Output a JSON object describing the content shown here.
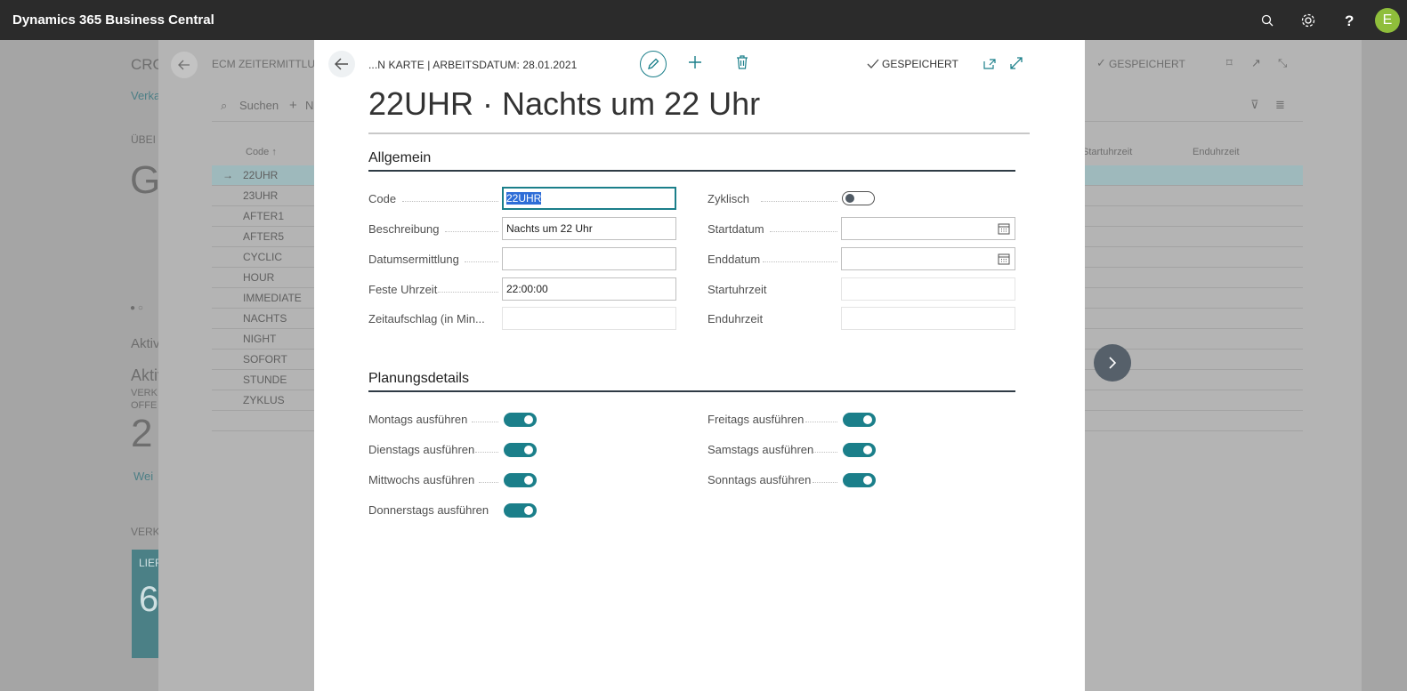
{
  "app": {
    "title": "Dynamics 365 Business Central",
    "user_initial": "E"
  },
  "background": {
    "company_partial": "CRO",
    "nav_partial": "Verka",
    "section_partial": "ÜBEI",
    "big_letter": "G",
    "aktiv1": "Aktiv",
    "aktiv2": "Aktiv",
    "verk1": "VERK",
    "offe": "OFFE",
    "count": "2",
    "weiter": "Wei",
    "verk2": "VERK",
    "tile_label": "LIEF",
    "tile_num": "6",
    "list_title": "ECM ZEITERMITTLUN",
    "search": "Suchen",
    "new_partial": "N",
    "saved": "GESPEICHERT",
    "columns": {
      "code": "Code ↑",
      "start": "Startuhrzeit",
      "end": "Enduhrzeit"
    },
    "rows": [
      "22UHR",
      "23UHR",
      "AFTER1",
      "AFTER5",
      "CYCLIC",
      "HOUR",
      "IMMEDIATE",
      "NACHTS",
      "NIGHT",
      "SOFORT",
      "STUNDE",
      "ZYKLUS",
      ""
    ]
  },
  "modal": {
    "breadcrumb": "...N KARTE | ARBEITSDATUM: 28.01.2021",
    "saved": "GESPEICHERT",
    "title": "22UHR · Nachts um 22 Uhr",
    "section_general": "Allgemein",
    "section_planning": "Planungsdetails",
    "fields": {
      "code": {
        "label": "Code",
        "value": "22UHR"
      },
      "beschreibung": {
        "label": "Beschreibung",
        "value": "Nachts um 22 Uhr"
      },
      "datumsermittlung": {
        "label": "Datumsermittlung",
        "value": ""
      },
      "feste_uhrzeit": {
        "label": "Feste Uhrzeit",
        "value": "22:00:00"
      },
      "zeitaufschlag": {
        "label": "Zeitaufschlag (in Min...",
        "value": ""
      },
      "zyklisch": {
        "label": "Zyklisch",
        "on": false
      },
      "startdatum": {
        "label": "Startdatum",
        "value": ""
      },
      "enddatum": {
        "label": "Enddatum",
        "value": ""
      },
      "startuhrzeit": {
        "label": "Startuhrzeit",
        "value": ""
      },
      "enduhrzeit": {
        "label": "Enduhrzeit",
        "value": ""
      }
    },
    "planning": {
      "montag": {
        "label": "Montags ausführen",
        "on": true
      },
      "dienstag": {
        "label": "Dienstags ausführen",
        "on": true
      },
      "mittwoch": {
        "label": "Mittwochs ausführen",
        "on": true
      },
      "donnerstag": {
        "label": "Donnerstags ausführen",
        "on": true
      },
      "freitag": {
        "label": "Freitags ausführen",
        "on": true
      },
      "samstag": {
        "label": "Samstags ausführen",
        "on": true
      },
      "sonntag": {
        "label": "Sonntags ausführen",
        "on": true
      }
    }
  },
  "colors": {
    "accent": "#1b7f8a",
    "appbar": "#2b2b2b",
    "avatar": "#8fbe3b"
  }
}
